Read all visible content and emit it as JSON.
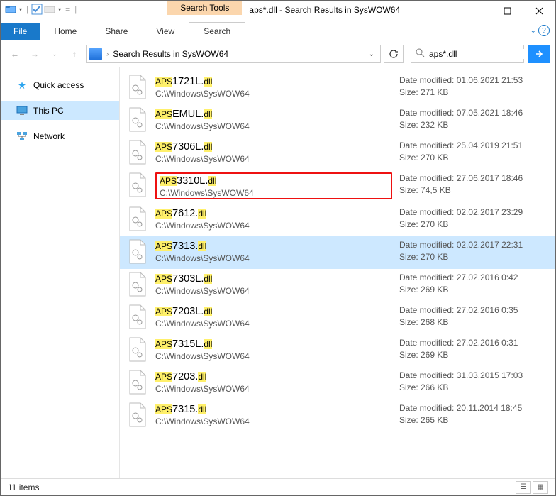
{
  "title": "aps*.dll - Search Results in SysWOW64",
  "context_tab_header": "Search Tools",
  "ribbon": {
    "file": "File",
    "home": "Home",
    "share": "Share",
    "view": "View",
    "search": "Search"
  },
  "address": {
    "text": "Search Results in SysWOW64"
  },
  "search": {
    "value": "aps*.dll"
  },
  "navpane": {
    "quick_access": "Quick access",
    "this_pc": "This PC",
    "network": "Network"
  },
  "meta_labels": {
    "date": "Date modified:",
    "size": "Size:"
  },
  "path_common": "C:\\Windows\\SysWOW64",
  "results": [
    {
      "pre": "APS",
      "mid": "1721L.",
      "ext": "dll",
      "date": "01.06.2021 21:53",
      "size": "271 KB",
      "red": false,
      "sel": false
    },
    {
      "pre": "APS",
      "mid": "EMUL.",
      "ext": "dll",
      "date": "07.05.2021 18:46",
      "size": "232 KB",
      "red": false,
      "sel": false
    },
    {
      "pre": "APS",
      "mid": "7306L.",
      "ext": "dll",
      "date": "25.04.2019 21:51",
      "size": "270 KB",
      "red": false,
      "sel": false
    },
    {
      "pre": "APS",
      "mid": "3310L.",
      "ext": "dll",
      "date": "27.06.2017 18:46",
      "size": "74,5 KB",
      "red": true,
      "sel": false
    },
    {
      "pre": "APS",
      "mid": "7612.",
      "ext": "dll",
      "date": "02.02.2017 23:29",
      "size": "270 KB",
      "red": false,
      "sel": false
    },
    {
      "pre": "APS",
      "mid": "7313.",
      "ext": "dll",
      "date": "02.02.2017 22:31",
      "size": "270 KB",
      "red": false,
      "sel": true
    },
    {
      "pre": "APS",
      "mid": "7303L.",
      "ext": "dll",
      "date": "27.02.2016 0:42",
      "size": "269 KB",
      "red": false,
      "sel": false
    },
    {
      "pre": "APS",
      "mid": "7203L.",
      "ext": "dll",
      "date": "27.02.2016 0:35",
      "size": "268 KB",
      "red": false,
      "sel": false
    },
    {
      "pre": "APS",
      "mid": "7315L.",
      "ext": "dll",
      "date": "27.02.2016 0:31",
      "size": "269 KB",
      "red": false,
      "sel": false
    },
    {
      "pre": "APS",
      "mid": "7203.",
      "ext": "dll",
      "date": "31.03.2015 17:03",
      "size": "266 KB",
      "red": false,
      "sel": false
    },
    {
      "pre": "APS",
      "mid": "7315.",
      "ext": "dll",
      "date": "20.11.2014 18:45",
      "size": "265 KB",
      "red": false,
      "sel": false
    }
  ],
  "status": {
    "count": "11 items"
  }
}
